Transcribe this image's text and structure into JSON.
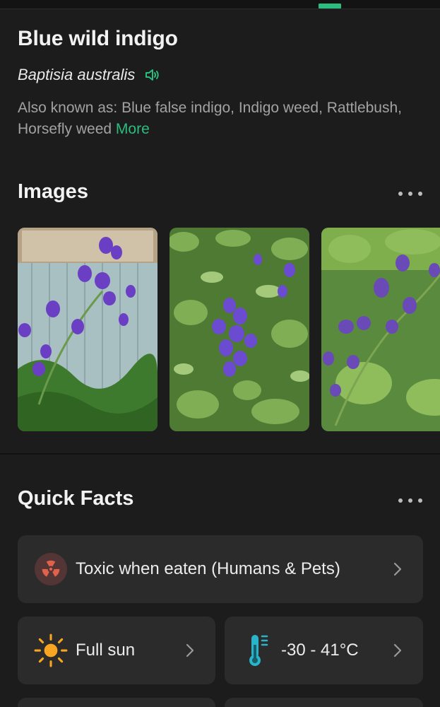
{
  "plant": {
    "common_name": "Blue wild indigo",
    "scientific_name": "Baptisia australis",
    "aka_prefix": "Also known as: Blue false indigo, Indigo weed, Rattlebush, Horsefly weed",
    "more_label": "More"
  },
  "images_section": {
    "heading": "Images",
    "thumbnails": [
      {
        "icon": "flower-photo-1"
      },
      {
        "icon": "flower-photo-2"
      },
      {
        "icon": "flower-photo-3"
      }
    ]
  },
  "quick_facts": {
    "heading": "Quick Facts",
    "toxicity": {
      "label": "Toxic when eaten (Humans & Pets)",
      "icon": "toxic-icon",
      "color": "#e0624a"
    },
    "sunlight": {
      "label": "Full sun",
      "icon": "sun-icon",
      "color": "#f6a623"
    },
    "hardiness": {
      "label": "-30 - 41°C",
      "icon": "thermometer-icon",
      "color": "#2bb3c9"
    }
  },
  "colors": {
    "accent": "#2bbd7e",
    "background": "#1c1c1c",
    "card": "#2b2b2b"
  }
}
